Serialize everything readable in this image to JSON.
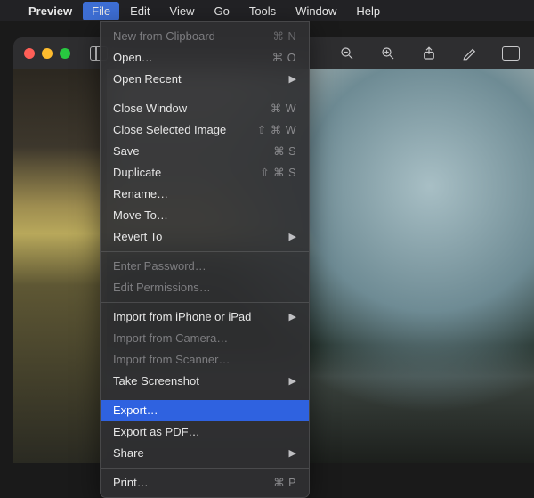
{
  "menubar": {
    "apple": "",
    "app_name": "Preview",
    "items": [
      "File",
      "Edit",
      "View",
      "Go",
      "Tools",
      "Window",
      "Help"
    ],
    "open_index": 0
  },
  "file_menu": {
    "groups": [
      [
        {
          "label": "New from Clipboard",
          "shortcut": "⌘ N",
          "disabled": true
        },
        {
          "label": "Open…",
          "shortcut": "⌘ O"
        },
        {
          "label": "Open Recent",
          "submenu": true
        }
      ],
      [
        {
          "label": "Close Window",
          "shortcut": "⌘ W"
        },
        {
          "label": "Close Selected Image",
          "shortcut": "⇧ ⌘ W"
        },
        {
          "label": "Save",
          "shortcut": "⌘ S"
        },
        {
          "label": "Duplicate",
          "shortcut": "⇧ ⌘ S"
        },
        {
          "label": "Rename…"
        },
        {
          "label": "Move To…"
        },
        {
          "label": "Revert To",
          "submenu": true
        }
      ],
      [
        {
          "label": "Enter Password…",
          "disabled": true
        },
        {
          "label": "Edit Permissions…",
          "disabled": true
        }
      ],
      [
        {
          "label": "Import from iPhone or iPad",
          "submenu": true
        },
        {
          "label": "Import from Camera…",
          "disabled": true
        },
        {
          "label": "Import from Scanner…",
          "disabled": true
        },
        {
          "label": "Take Screenshot",
          "submenu": true
        }
      ],
      [
        {
          "label": "Export…",
          "highlight": true
        },
        {
          "label": "Export as PDF…"
        },
        {
          "label": "Share",
          "submenu": true
        }
      ],
      [
        {
          "label": "Print…",
          "shortcut": "⌘ P"
        }
      ]
    ]
  },
  "toolbar_icons": {
    "sidebar": "sidebar-toggle-icon",
    "zoom_out": "zoom-out-icon",
    "zoom_in": "zoom-in-icon",
    "share": "share-icon",
    "markup": "markup-icon",
    "rotate": "rotate-icon"
  }
}
